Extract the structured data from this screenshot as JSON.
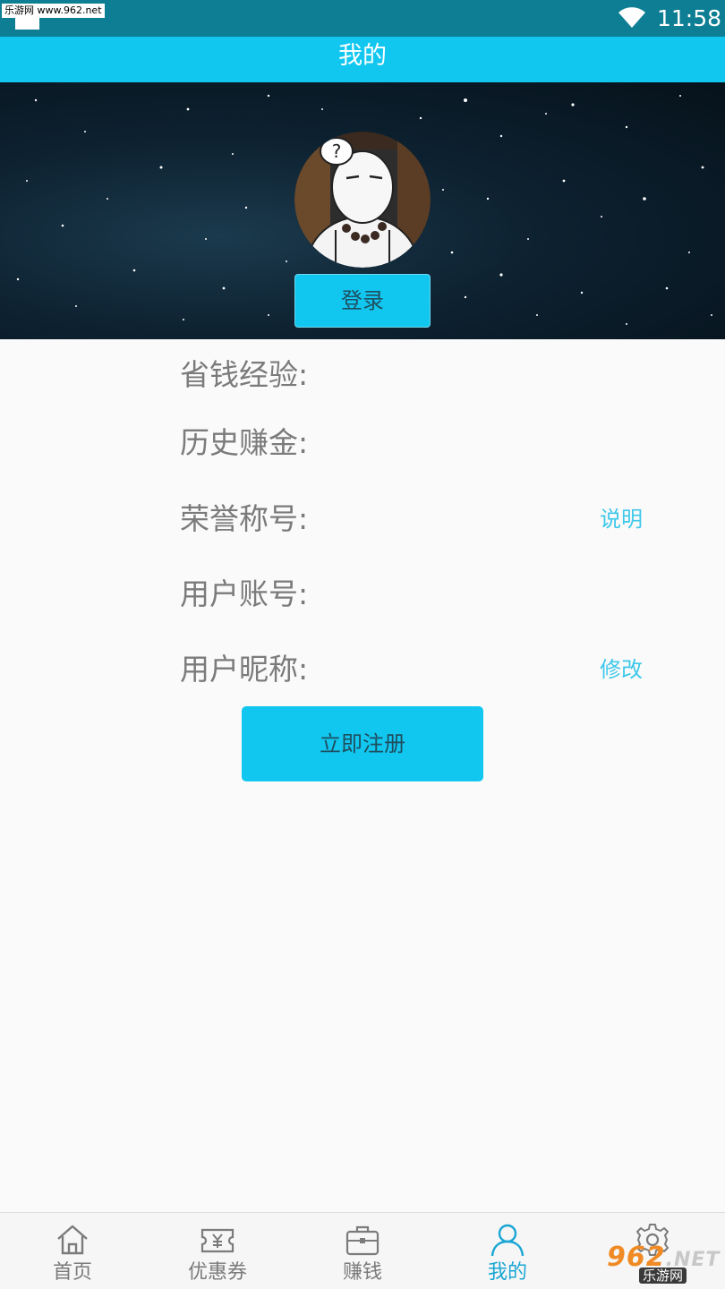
{
  "status_bar": {
    "watermark": "乐游网 www.962.net",
    "time": "11:58",
    "icons": [
      "wifi-icon"
    ]
  },
  "header": {
    "title": "我的"
  },
  "profile": {
    "avatar_icon": "user-avatar-cartoon",
    "login_label": "登录"
  },
  "info_rows": [
    {
      "label": "省钱经验:",
      "action": ""
    },
    {
      "label": "历史赚金:",
      "action": ""
    },
    {
      "label": "荣誉称号:",
      "action": "说明"
    },
    {
      "label": "用户账号:",
      "action": ""
    },
    {
      "label": "用户昵称:",
      "action": "修改"
    }
  ],
  "register_label": "立即注册",
  "bottom_nav": {
    "active_index": 3,
    "items": [
      {
        "label": "首页",
        "icon": "home-icon"
      },
      {
        "label": "优惠券",
        "icon": "coupon-icon"
      },
      {
        "label": "赚钱",
        "icon": "briefcase-icon"
      },
      {
        "label": "我的",
        "icon": "person-icon"
      },
      {
        "label": "",
        "icon": "gear-icon"
      }
    ]
  },
  "watermark_logo": {
    "main": "962",
    "suffix": ".NET",
    "sub": "乐游网"
  },
  "colors": {
    "status_bar": "#0e7e94",
    "accent": "#11c7f0",
    "link": "#3ec8ea",
    "label_text": "#7b7b7b",
    "active_nav": "#1aa6d4"
  }
}
